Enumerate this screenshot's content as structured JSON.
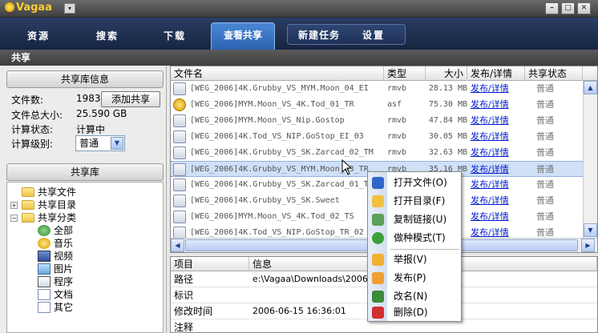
{
  "window": {
    "app_name": "Vagaa",
    "min_glyph": "–",
    "max_glyph": "□",
    "close_glyph": "✕",
    "sysmenu_glyph": "▾"
  },
  "nav": {
    "items": [
      "资源",
      "搜索",
      "下载"
    ],
    "active": "查看共享",
    "group": [
      "新建任务",
      "设置"
    ]
  },
  "section_title": "共享",
  "library_info": {
    "header": "共享库信息",
    "file_count_label": "文件数:",
    "file_count": "1983",
    "add_share_button": "添加共享",
    "total_size_label": "文件总大小:",
    "total_size": "25.590 GB",
    "calc_status_label": "计算状态:",
    "calc_status": "计算中",
    "calc_level_label": "计算级别:",
    "calc_level": "普通"
  },
  "library": {
    "header": "共享库",
    "tree": {
      "shared_files": "共享文件",
      "shared_dirs": "共享目录",
      "shared_categories": "共享分类",
      "categories": [
        "全部",
        "音乐",
        "视频",
        "图片",
        "程序",
        "文档",
        "其它"
      ]
    }
  },
  "file_list": {
    "columns": {
      "name": "文件名",
      "type": "类型",
      "size": "大小",
      "publish": "发布/详情",
      "status": "共享状态"
    },
    "rows": [
      {
        "name": "[WEG_2006]4K.Grubby_VS_MYM.Moon_04_EI",
        "type": "rmvb",
        "size": "28.13 MB",
        "publish": "发布/详情",
        "status": "普通"
      },
      {
        "name": "[WEG_2006]MYM.Moon_VS_4K.Tod_01_TR",
        "type": "asf",
        "size": "75.30 MB",
        "publish": "发布/详情",
        "status": "普通"
      },
      {
        "name": "[WEG_2006]MYM.Moon_VS_Nip.Gostop",
        "type": "rmvb",
        "size": "47.84 MB",
        "publish": "发布/详情",
        "status": "普通"
      },
      {
        "name": "[WEG_2006]4K.Tod_VS_NIP.GoStop_EI_03",
        "type": "rmvb",
        "size": "30.05 MB",
        "publish": "发布/详情",
        "status": "普通"
      },
      {
        "name": "[WEG_2006]4K.Grubby_VS_SK.Zarcad_02_TM",
        "type": "rmvb",
        "size": "32.63 MB",
        "publish": "发布/详情",
        "status": "普通"
      },
      {
        "name": "[WEG_2006]4K.Grubby_VS_MYM.Moon_03_TR",
        "type": "rmvb",
        "size": "35.16 MB",
        "publish": "发布/详情",
        "status": "普通"
      },
      {
        "name": "[WEG_2006]4K.Grubby_VS_SK.Zarcad_01_TS",
        "type": "",
        "size": "",
        "publish": "发布/详情",
        "status": "普通"
      },
      {
        "name": "[WEG_2006]4K.Grubby_VS_SK.Sweet",
        "type": "",
        "size": "",
        "publish": "发布/详情",
        "status": "普通"
      },
      {
        "name": "[WEG_2006]MYM.Moon_VS_4K.Tod_02_TS",
        "type": "",
        "size": "",
        "publish": "发布/详情",
        "status": "普通"
      },
      {
        "name": "[WEG_2006]4K.Tod_VS_NIP.GoStop_TR_02",
        "type": "",
        "size": "",
        "publish": "发布/详情",
        "status": "普通"
      }
    ]
  },
  "details": {
    "columns": {
      "item": "项目",
      "info": "信息"
    },
    "rows": [
      {
        "key": "路径",
        "value": "e:\\Vagaa\\Downloads\\2006周"
      },
      {
        "key": "标识",
        "value": ""
      },
      {
        "key": "修改时间",
        "value": "2006-06-15 16:36:01"
      },
      {
        "key": "注释",
        "value": ""
      }
    ]
  },
  "context_menu": {
    "items": [
      {
        "label": "打开文件(O)",
        "icon": "play-icon",
        "color": "#2f67c9"
      },
      {
        "label": "打开目录(F)",
        "icon": "folder-open-icon",
        "color": "#f0c040"
      },
      {
        "label": "复制链接(U)",
        "icon": "copy-link-icon",
        "color": "#5aa05a"
      },
      {
        "label": "做种模式(T)",
        "icon": "seed-icon",
        "color": "#3aa03a"
      },
      {
        "label": "举报(V)",
        "icon": "report-icon",
        "color": "#f0b030"
      },
      {
        "label": "发布(P)",
        "icon": "publish-icon",
        "color": "#f0a030"
      },
      {
        "label": "改名(N)",
        "icon": "rename-icon",
        "color": "#3a8a3a"
      },
      {
        "label": "删除(D)",
        "icon": "delete-icon",
        "color": "#d03030"
      }
    ]
  }
}
